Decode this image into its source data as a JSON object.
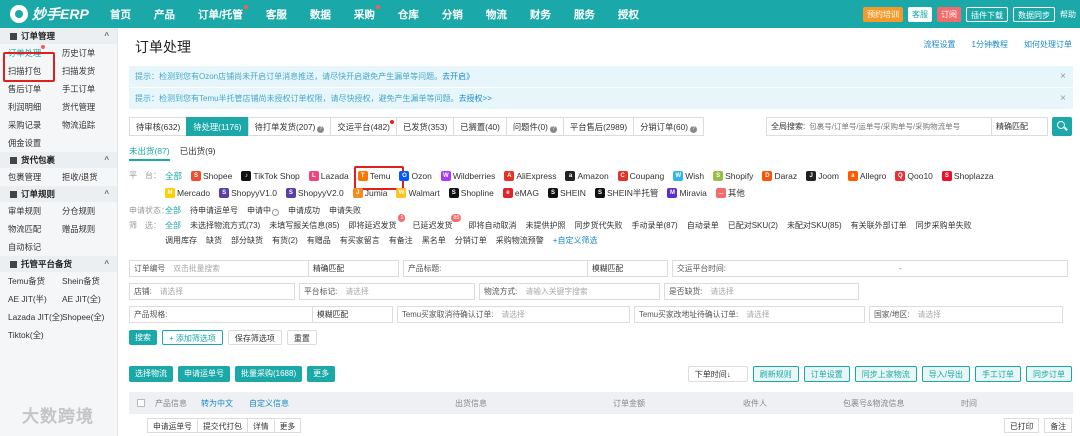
{
  "brand": {
    "name": "妙手ERP"
  },
  "nav": [
    {
      "label": "首页",
      "dot": false
    },
    {
      "label": "产品",
      "dot": false
    },
    {
      "label": "订单/托管",
      "dot": true
    },
    {
      "label": "客服",
      "dot": false
    },
    {
      "label": "数据",
      "dot": false
    },
    {
      "label": "采购",
      "dot": true
    },
    {
      "label": "仓库",
      "dot": false
    },
    {
      "label": "分销",
      "dot": false
    },
    {
      "label": "物流",
      "dot": false
    },
    {
      "label": "财务",
      "dot": false
    },
    {
      "label": "服务",
      "dot": false
    },
    {
      "label": "授权",
      "dot": false
    }
  ],
  "topright": {
    "appointment": "预约培训",
    "service": "客服",
    "order": "订阅",
    "plugin": "插件下载",
    "sync": "数据同步",
    "help": "帮助"
  },
  "sidebar": {
    "groups": [
      {
        "title": "订单管理",
        "rows": [
          [
            "订单处理",
            "历史订单"
          ],
          [
            "扫描打包",
            "扫描发货"
          ],
          [
            "售后订单",
            "手工订单"
          ],
          [
            "利润明细",
            "货代管理"
          ],
          [
            "采购记录",
            "物流追踪"
          ],
          [
            "佣金设置"
          ]
        ]
      },
      {
        "title": "货代包裹",
        "rows": [
          [
            "包裹管理",
            "拒收/退货"
          ]
        ]
      },
      {
        "title": "订单规则",
        "rows": [
          [
            "审单规则",
            "分仓规则"
          ],
          [
            "物流匹配",
            "赠品规则"
          ],
          [
            "自动标记"
          ]
        ]
      },
      {
        "title": "托管平台备货",
        "rows": [
          [
            "Temu备货",
            "Shein备货"
          ],
          [
            "AE JIT(半)",
            "AE JIT(全)"
          ],
          [
            "Lazada JIT(全)",
            "Shopee(全)"
          ],
          [
            "Tiktok(全)"
          ]
        ]
      }
    ]
  },
  "page": {
    "title": "订单处理",
    "links": [
      "流程设置",
      "1分钟教程",
      "如何处理订单"
    ],
    "notices": [
      {
        "text": "提示：检测到您有Ozon店铺尚未开启订单消息推送，请尽快开启避免产生漏单等问题。",
        "link": "去开启》"
      },
      {
        "text": "提示：检测到您有Temu半托管店铺尚未授权订单权限，请尽快授权，避免产生漏单等问题。",
        "link": "去授权>>"
      }
    ]
  },
  "tabs": [
    {
      "label": "待审核(632)",
      "active": false,
      "q": false,
      "dot": false
    },
    {
      "label": "待处理(1176)",
      "active": true,
      "q": false,
      "dot": false
    },
    {
      "label": "待打单发货(207)",
      "active": false,
      "q": true,
      "dot": false
    },
    {
      "label": "交运平台(482)",
      "active": false,
      "q": false,
      "dot": true
    },
    {
      "label": "已发货(353)",
      "active": false,
      "q": false,
      "dot": false
    },
    {
      "label": "已搁置(40)",
      "active": false,
      "q": false,
      "dot": false
    },
    {
      "label": "问题件(0)",
      "active": false,
      "q": true,
      "dot": false
    },
    {
      "label": "平台售后(2989)",
      "active": false,
      "q": false,
      "dot": false
    },
    {
      "label": "分销订单(60)",
      "active": false,
      "q": true,
      "dot": false
    }
  ],
  "search": {
    "label": "全局搜索:",
    "placeholder": "包裹号/订单号/运单号/采购单号/采购物流单号",
    "mode": "精确匹配"
  },
  "subtabs": [
    "未出货(87)",
    "已出货(9)"
  ],
  "platforms": {
    "label": "平　台：",
    "row1": [
      {
        "name": "全部",
        "icon": "",
        "color": "",
        "all": true
      },
      {
        "name": "Shopee",
        "icon": "S",
        "color": "#ee4d2d"
      },
      {
        "name": "TikTok Shop",
        "icon": "♪",
        "color": "#111111"
      },
      {
        "name": "Lazada",
        "icon": "L",
        "color": "#f0447b"
      },
      {
        "name": "Temu",
        "icon": "T",
        "color": "#fb7701",
        "boxed": true
      },
      {
        "name": "Ozon",
        "icon": "O",
        "color": "#005bff"
      },
      {
        "name": "Wildberries",
        "icon": "W",
        "color": "#a73afd"
      },
      {
        "name": "AliExpress",
        "icon": "A",
        "color": "#e43225"
      },
      {
        "name": "Amazon",
        "icon": "a",
        "color": "#222222"
      },
      {
        "name": "Coupang",
        "icon": "C",
        "color": "#e2342b"
      },
      {
        "name": "Wish",
        "icon": "W",
        "color": "#2fb7ec"
      },
      {
        "name": "Shopify",
        "icon": "S",
        "color": "#95bf47"
      },
      {
        "name": "Daraz",
        "icon": "D",
        "color": "#f85606"
      },
      {
        "name": "Joom",
        "icon": "J",
        "color": "#222222"
      },
      {
        "name": "Allegro",
        "icon": "a",
        "color": "#ff5a00"
      },
      {
        "name": "Qoo10",
        "icon": "Q",
        "color": "#e53238"
      },
      {
        "name": "Shoplazza",
        "icon": "S",
        "color": "#e8132b"
      }
    ],
    "row2": [
      {
        "name": "Mercado",
        "icon": "M",
        "color": "#ffcd00"
      },
      {
        "name": "ShopyyV1.0",
        "icon": "S",
        "color": "#5a3ea8"
      },
      {
        "name": "ShopyyV2.0",
        "icon": "S",
        "color": "#5a3ea8"
      },
      {
        "name": "Jumia",
        "icon": "J",
        "color": "#f68b1e"
      },
      {
        "name": "Walmart",
        "icon": "W",
        "color": "#ffc220"
      },
      {
        "name": "Shopline",
        "icon": "S",
        "color": "#111111"
      },
      {
        "name": "eMAG",
        "icon": "e",
        "color": "#e0242b"
      },
      {
        "name": "SHEIN",
        "icon": "S",
        "color": "#111111"
      },
      {
        "name": "SHEIN半托管",
        "icon": "S",
        "color": "#111111"
      },
      {
        "name": "Miravia",
        "icon": "M",
        "color": "#5b2bd6"
      },
      {
        "name": "其他",
        "icon": "…",
        "color": "#f26c6c"
      }
    ]
  },
  "apply_status": {
    "label": "申请状态：",
    "items": [
      "全部",
      "待申请运单号",
      "申请中",
      "申请成功",
      "申请失败"
    ],
    "q_index": 2
  },
  "filter": {
    "label": "筛　选：",
    "row1": [
      {
        "t": "全部",
        "all": true
      },
      {
        "t": "未选择物流方式(73)"
      },
      {
        "t": "未填写报关信息(85)"
      },
      {
        "t": "即将延迟发货",
        "badge": "1"
      },
      {
        "t": "已延迟发货",
        "badge": "85"
      },
      {
        "t": "即将自动取消"
      },
      {
        "t": "未提供护照"
      },
      {
        "t": "同步货代失败"
      },
      {
        "t": "手动录单(87)"
      },
      {
        "t": "自动录单"
      },
      {
        "t": "已配对SKU(2)"
      },
      {
        "t": "未配对SKU(85)"
      },
      {
        "t": "有关联外部订单"
      },
      {
        "t": "同步采购单失败"
      }
    ],
    "row2": [
      {
        "t": "调用库存"
      },
      {
        "t": "缺货"
      },
      {
        "t": "部分缺货"
      },
      {
        "t": "有货(2)"
      },
      {
        "t": "有赠品"
      },
      {
        "t": "有买家留言"
      },
      {
        "t": "有备注"
      },
      {
        "t": "黑名单"
      },
      {
        "t": "分销订单"
      },
      {
        "t": "采购物流预警"
      },
      {
        "t": "+自定义筛选",
        "link": true
      }
    ]
  },
  "form": {
    "order_no": {
      "label": "订单编号",
      "placeholder": "双击批量搜索",
      "mode": "精确匹配"
    },
    "product_title": {
      "label": "产品标题:",
      "mode": "模糊匹配"
    },
    "ship_time": {
      "label": "交运平台时间:",
      "sep": "-"
    },
    "store": {
      "label": "店铺:",
      "placeholder": "请选择"
    },
    "platform_tag": {
      "label": "平台标记:",
      "placeholder": "请选择"
    },
    "logistics": {
      "label": "物流方式:",
      "placeholder": "请输入关键字搜索"
    },
    "out_of_stock": {
      "label": "是否缺货:",
      "placeholder": "请选择"
    },
    "spec": {
      "label": "产品规格:",
      "mode": "模糊匹配"
    },
    "temu_cancel": {
      "label": "Temu买家取消待确认订单:",
      "placeholder": "请选择"
    },
    "temu_address": {
      "label": "Temu买家改地址待确认订单:",
      "placeholder": "请选择"
    },
    "country": {
      "label": "国家/地区:",
      "placeholder": "请选择"
    }
  },
  "actions": {
    "search": "搜索",
    "add_filter": "+ 添加筛选项",
    "save_filter": "保存筛选项",
    "reset": "重置"
  },
  "buttons_left": [
    "选择物流",
    "申请运单号",
    "批量采购(1688)",
    "更多"
  ],
  "buttons_right": {
    "sort": "下单时间↓",
    "refresh": "刷新规则",
    "order_settings": "订单设置",
    "sync_logistics": "同步上家物流",
    "import_export": "导入/导出",
    "manual": "手工订单",
    "sync_order": "同步订单"
  },
  "table_header": {
    "product": "产品信息",
    "translate": "转为中文",
    "custom": "自定义信息",
    "ship": "出货信息",
    "amount": "订单金额",
    "receiver": "收件人",
    "package": "包裹号&物流信息",
    "time": "时间"
  },
  "bottom_left": [
    "申请运单号",
    "提交代打包",
    "详情",
    "更多"
  ],
  "bottom_right": {
    "print": "已打印",
    "note": "备注"
  },
  "watermark": "大数跨境"
}
